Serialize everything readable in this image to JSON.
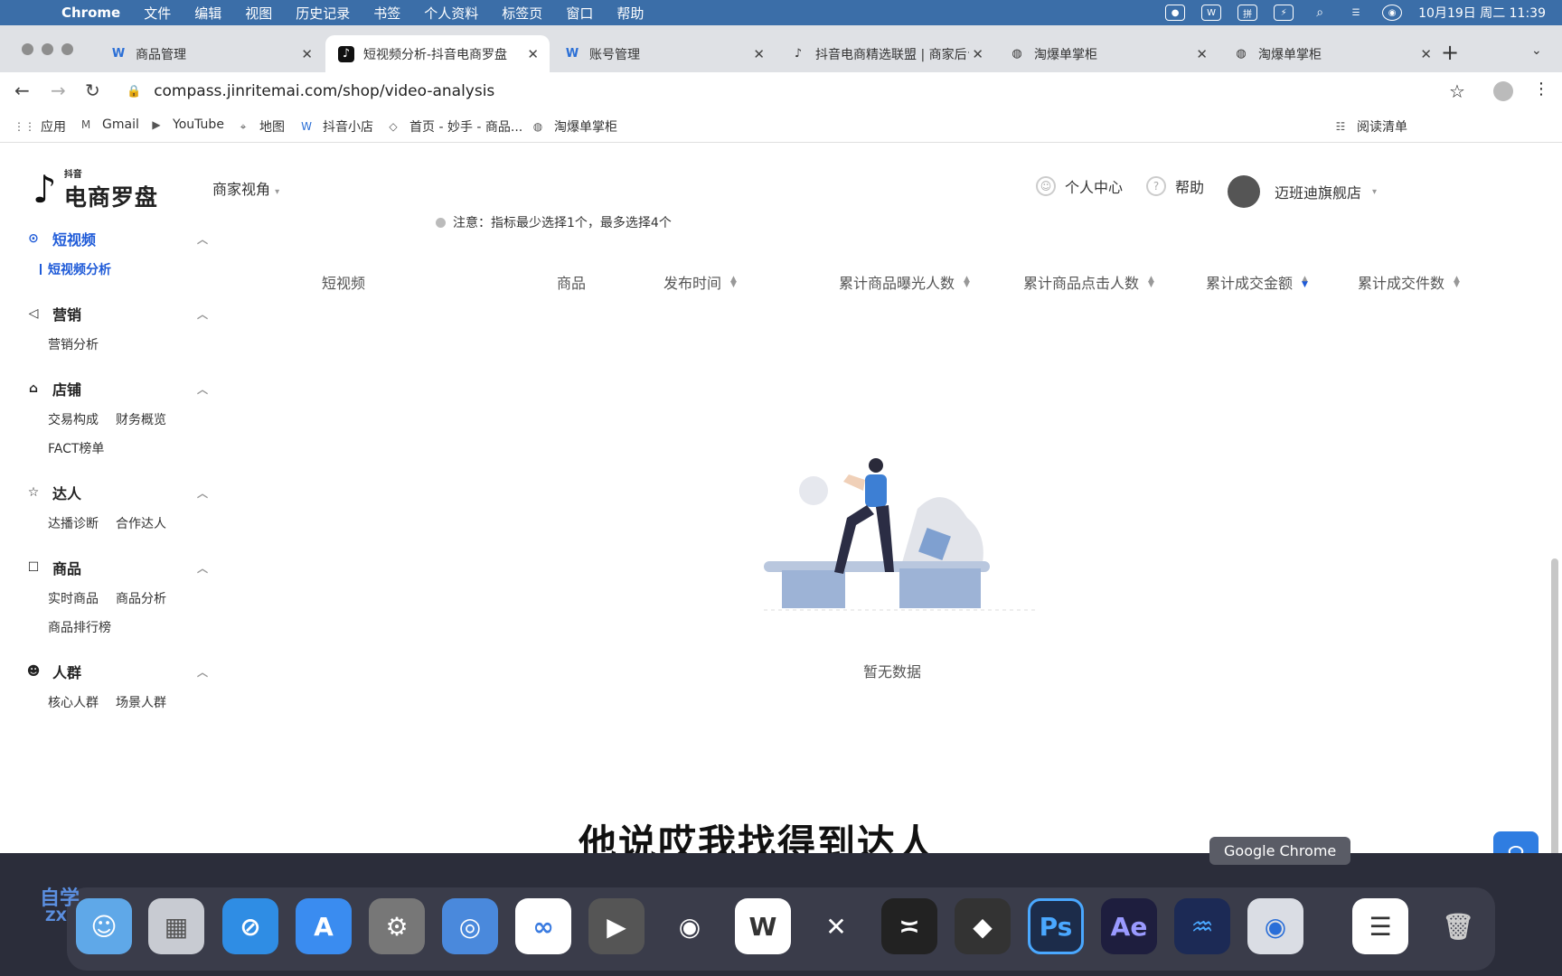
{
  "macbar": {
    "app": "Chrome",
    "menus": [
      "文件",
      "编辑",
      "视图",
      "历史记录",
      "书签",
      "个人资料",
      "标签页",
      "窗口",
      "帮助"
    ],
    "clock": "10月19日 周二  11:39"
  },
  "tabs": [
    {
      "title": "商品管理"
    },
    {
      "title": "短视频分析-抖音电商罗盘"
    },
    {
      "title": "账号管理"
    },
    {
      "title": "抖音电商精选联盟 | 商家后台"
    },
    {
      "title": "淘爆单掌柜"
    },
    {
      "title": "淘爆单掌柜"
    }
  ],
  "address": {
    "url": "compass.jinritemai.com/shop/video-analysis"
  },
  "bookmarks": [
    {
      "label": "应用"
    },
    {
      "label": "Gmail"
    },
    {
      "label": "YouTube"
    },
    {
      "label": "地图"
    },
    {
      "label": "抖音小店"
    },
    {
      "label": "首页 - 妙手 - 商品..."
    },
    {
      "label": "淘爆单掌柜"
    },
    {
      "label": "阅读清单"
    }
  ],
  "logo": {
    "small": "抖音",
    "big": "电商罗盘"
  },
  "perspective": "商家视角",
  "header_right": {
    "personal": "个人中心",
    "help": "帮助",
    "store": "迈班迪旗舰店"
  },
  "sidebar": {
    "short_video": {
      "title": "短视频",
      "items": [
        "短视频分析"
      ]
    },
    "marketing": {
      "title": "营销",
      "items": [
        "营销分析"
      ]
    },
    "store": {
      "title": "店铺",
      "items": [
        "交易构成",
        "财务概览",
        "FACT榜单"
      ]
    },
    "talent": {
      "title": "达人",
      "items": [
        "达播诊断",
        "合作达人"
      ]
    },
    "product": {
      "title": "商品",
      "items": [
        "实时商品",
        "商品分析",
        "商品排行榜"
      ]
    },
    "crowd": {
      "title": "人群",
      "items": [
        "核心人群",
        "场景人群"
      ]
    }
  },
  "notice": "注意：指标最少选择1个，最多选择4个",
  "table": {
    "columns": [
      "短视频",
      "商品",
      "发布时间",
      "累计商品曝光人数",
      "累计商品点击人数",
      "累计成交金额",
      "累计成交件数"
    ]
  },
  "empty_text": "暂无数据",
  "subtitle": "他说哎我找得到达人",
  "tooltip": "Google Chrome",
  "watermark": {
    "line1": "自学",
    "line2": "ZX"
  },
  "dock": [
    "Finder",
    "Launchpad",
    "Safari",
    "App Store",
    "System Preferences",
    "WeChat",
    "Baidu Netdisk",
    "Final Cut",
    "NetEase Music",
    "WPS",
    "CapCut X",
    "CapCut",
    "DaVinci",
    "Ps",
    "Ae",
    "Audio",
    "Google Chrome",
    "Preview",
    "Trash"
  ]
}
